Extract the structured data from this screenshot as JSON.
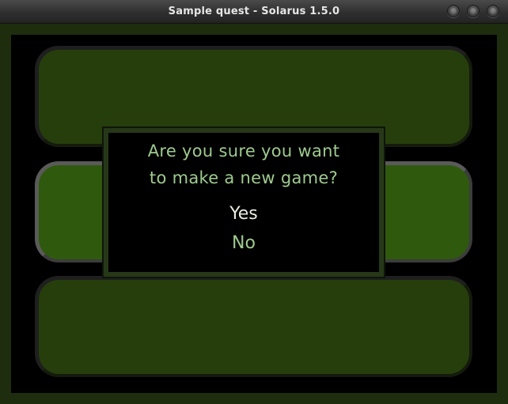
{
  "window": {
    "title": "Sample quest - Solarus 1.5.0"
  },
  "dialog": {
    "question_line1": "Are you sure you want",
    "question_line2": "to make a new game?",
    "choices": [
      {
        "label": "Yes",
        "selected": true
      },
      {
        "label": "No",
        "selected": false
      }
    ]
  },
  "save_slots": [
    {
      "state": "empty"
    },
    {
      "state": "highlighted"
    },
    {
      "state": "empty"
    }
  ],
  "colors": {
    "text_default": "#9ecb8f",
    "text_selected": "#e9ece0",
    "slot_fill": "#263e0c",
    "slot_highlight_fill": "#2f5a0d",
    "frame": "#1f2d0f"
  }
}
